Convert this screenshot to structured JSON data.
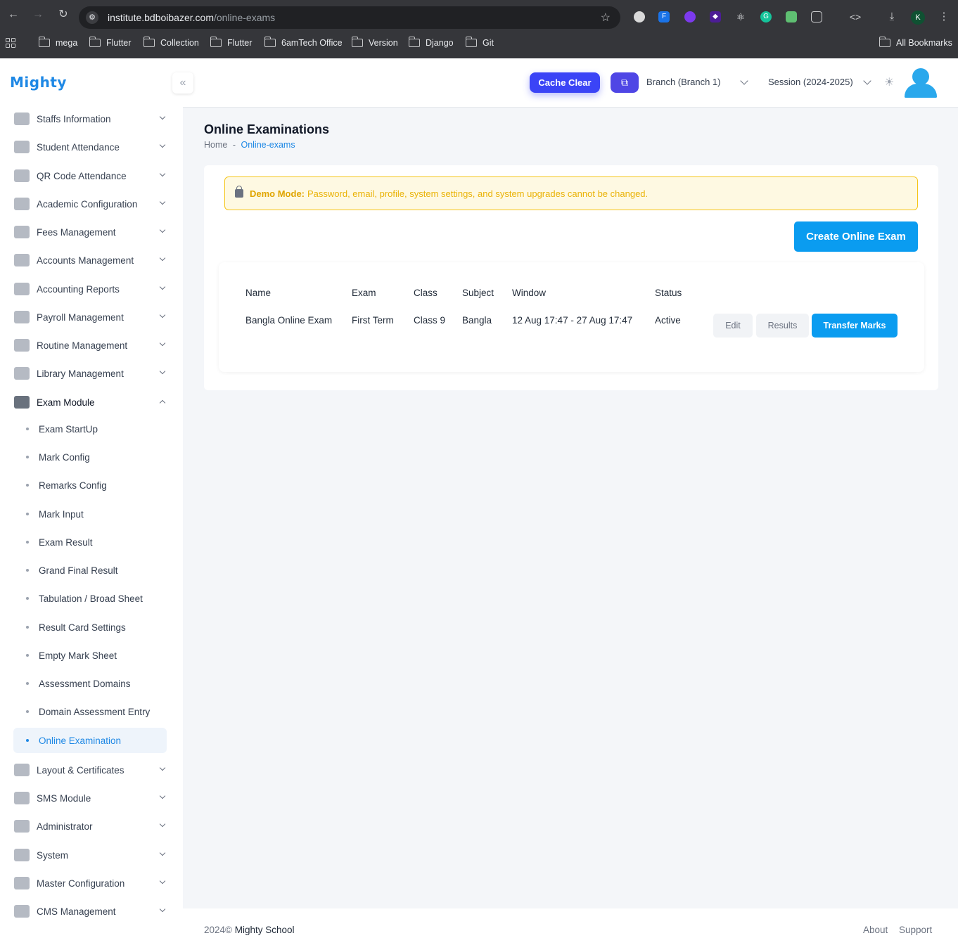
{
  "browser": {
    "url_domain": "institute.bdboibazer.com",
    "url_path": "/online-exams",
    "profile_initial": "K",
    "bookmarks": [
      "mega",
      "Flutter",
      "Collection",
      "Flutter",
      "6amTech Office",
      "Version",
      "Django",
      "Git"
    ],
    "all_bookmarks": "All Bookmarks"
  },
  "header": {
    "logo": "Mighty",
    "cache_clear": "Cache Clear",
    "branch": "Branch (Branch 1)",
    "session": "Session (2024-2025)"
  },
  "sidebar": {
    "items": [
      {
        "label": "Staffs Information",
        "icon": "staff-icon"
      },
      {
        "label": "Student Attendance",
        "icon": "fingerprint-icon"
      },
      {
        "label": "QR Code Attendance",
        "icon": "qr-code-icon"
      },
      {
        "label": "Academic Configuration",
        "icon": "academic-icon"
      },
      {
        "label": "Fees Management",
        "icon": "money-icon"
      },
      {
        "label": "Accounts Management",
        "icon": "bank-icon"
      },
      {
        "label": "Accounting Reports",
        "icon": "chart-icon"
      },
      {
        "label": "Payroll Management",
        "icon": "payroll-icon"
      },
      {
        "label": "Routine Management",
        "icon": "book-icon"
      },
      {
        "label": "Library Management",
        "icon": "library-icon"
      },
      {
        "label": "Exam Module",
        "icon": "layout-icon"
      }
    ],
    "exam_sub": [
      "Exam StartUp",
      "Mark Config",
      "Remarks Config",
      "Mark Input",
      "Exam Result",
      "Grand Final Result",
      "Tabulation / Broad Sheet",
      "Result Card Settings",
      "Empty Mark Sheet",
      "Assessment Domains",
      "Domain Assessment Entry",
      "Online Examination"
    ],
    "items_after": [
      {
        "label": "Layout & Certificates",
        "icon": "badge-icon"
      },
      {
        "label": "SMS Module",
        "icon": "sms-icon"
      },
      {
        "label": "Administrator",
        "icon": "admin-icon"
      },
      {
        "label": "System",
        "icon": "server-icon"
      },
      {
        "label": "Master Configuration",
        "icon": "rocket-icon"
      },
      {
        "label": "CMS Management",
        "icon": "cms-icon"
      }
    ]
  },
  "page": {
    "title": "Online Examinations",
    "breadcrumb_home": "Home",
    "breadcrumb_sep": "-",
    "breadcrumb_current": "Online-exams"
  },
  "alert": {
    "title": "Demo Mode:",
    "text": "Password, email, profile, system settings, and system upgrades cannot be changed."
  },
  "create_button": "Create Online Exam",
  "table": {
    "headers": [
      "Name",
      "Exam",
      "Class",
      "Subject",
      "Window",
      "Status"
    ],
    "rows": [
      {
        "name": "Bangla Online Exam",
        "exam": "First Term",
        "class": "Class 9",
        "subject": "Bangla",
        "window": "12 Aug 17:47 - 27 Aug 17:47",
        "status": "Active"
      }
    ],
    "actions": {
      "edit": "Edit",
      "results": "Results",
      "transfer": "Transfer Marks"
    }
  },
  "footer": {
    "year": "2024©",
    "brand": "Mighty School",
    "about": "About",
    "support": "Support"
  },
  "colors": {
    "accent": "#0a9cf0",
    "cache_button": "#3b44f6",
    "alert_bg": "#fef9e2",
    "alert_text": "#eab308"
  }
}
